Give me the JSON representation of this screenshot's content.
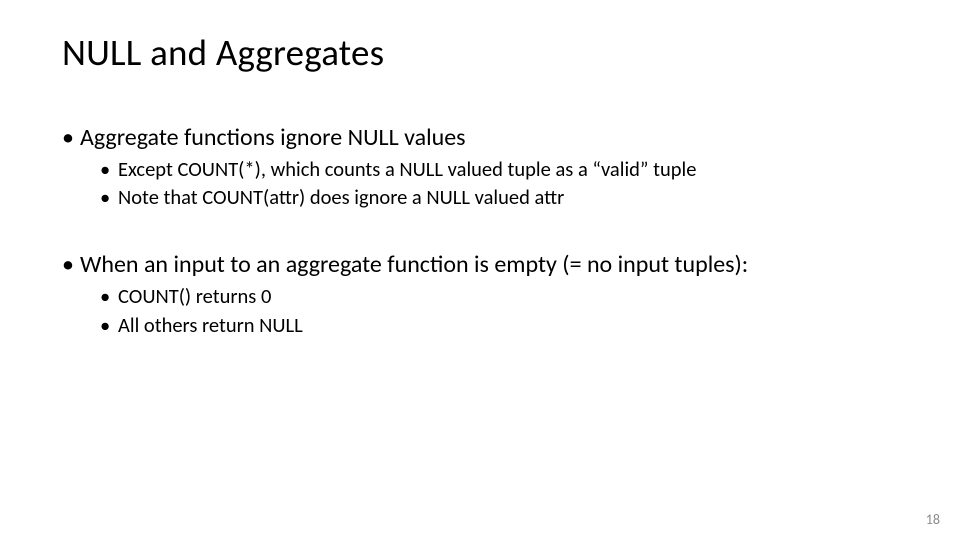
{
  "title": "NULL and Aggregates",
  "bullets": [
    {
      "text": "Aggregate functions ignore NULL values",
      "sub": [
        "Except COUNT(*), which counts a NULL valued tuple as a “valid” tuple",
        "Note that COUNT(attr) does ignore a NULL valued attr"
      ]
    },
    {
      "text": "When an input to an aggregate function is empty (= no input tuples):",
      "sub": [
        "COUNT() returns 0",
        "All others return NULL"
      ]
    }
  ],
  "page_number": "18"
}
